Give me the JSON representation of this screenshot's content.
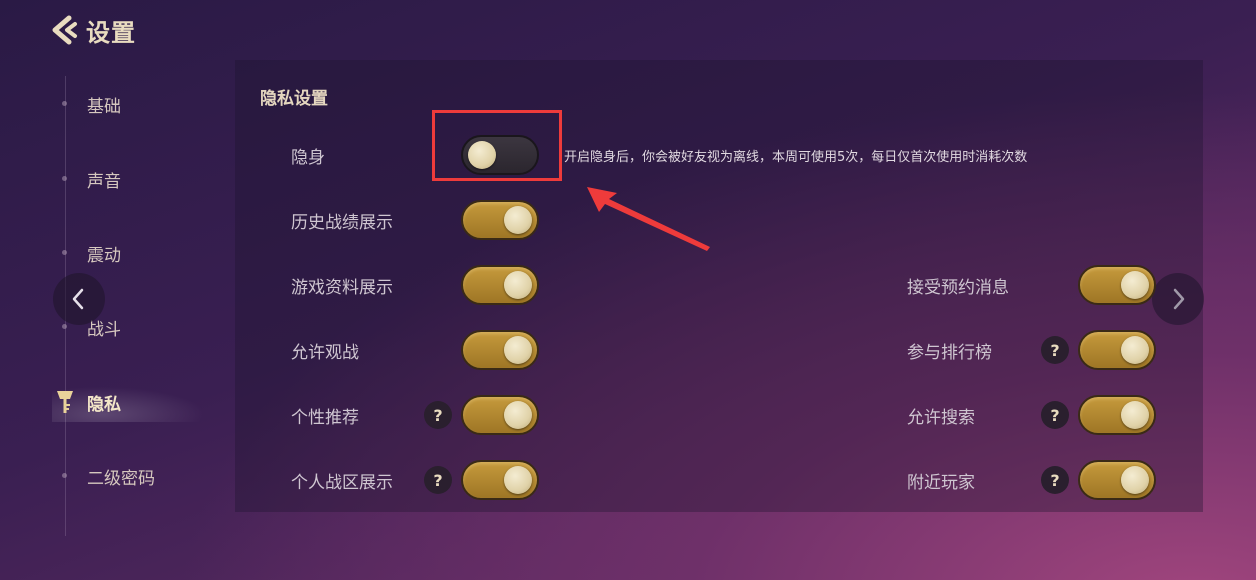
{
  "header": {
    "title": "设置"
  },
  "sidebar": {
    "items": [
      {
        "label": "基础"
      },
      {
        "label": "声音"
      },
      {
        "label": "震动"
      },
      {
        "label": "战斗"
      },
      {
        "label": "隐私"
      },
      {
        "label": "二级密码"
      }
    ],
    "active_index": 4
  },
  "panel": {
    "section_title": "隐私设置",
    "stealth": {
      "label": "隐身",
      "on": false,
      "description": "开启隐身后，你会被好友视为离线，本周可使用5次，每日仅首次使用时消耗次数"
    },
    "left_settings": [
      {
        "label": "历史战绩展示",
        "on": true,
        "help": false
      },
      {
        "label": "游戏资料展示",
        "on": true,
        "help": false
      },
      {
        "label": "允许观战",
        "on": true,
        "help": false
      },
      {
        "label": "个性推荐",
        "on": true,
        "help": true
      },
      {
        "label": "个人战区展示",
        "on": true,
        "help": true
      }
    ],
    "right_settings": [
      {
        "label": "接受预约消息",
        "on": true,
        "help": false
      },
      {
        "label": "参与排行榜",
        "on": true,
        "help": true
      },
      {
        "label": "允许搜索",
        "on": true,
        "help": true
      },
      {
        "label": "附近玩家",
        "on": true,
        "help": true
      }
    ],
    "help_glyph": "?"
  },
  "colors": {
    "accent_gold": "#c59a3c",
    "annotation_red": "#ee3b3b",
    "toggle_off": "#3c3640"
  }
}
